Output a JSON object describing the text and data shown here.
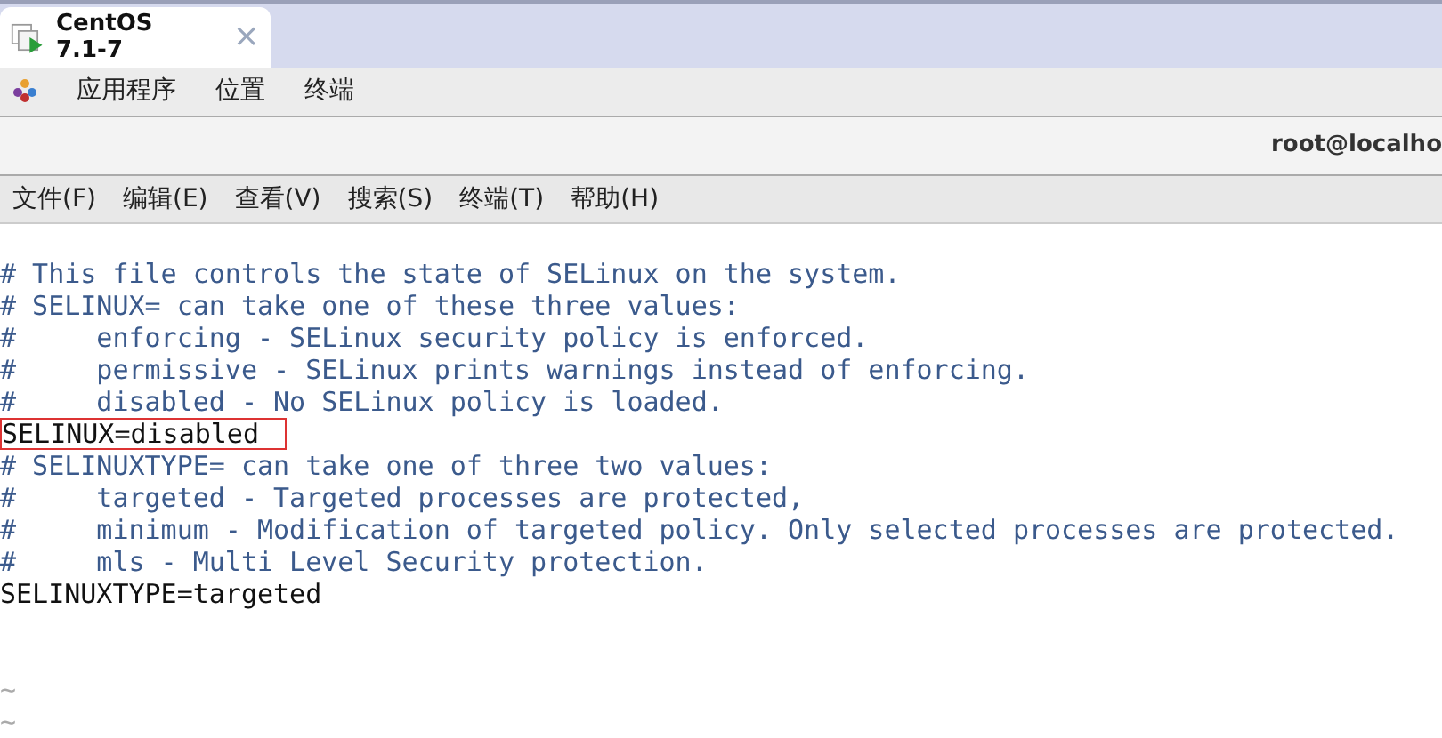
{
  "tabs": [
    {
      "label": "CentOS 7.1-7",
      "selected": true,
      "close": "×"
    }
  ],
  "top_menu": [
    "应用程序",
    "位置",
    "终端"
  ],
  "window": {
    "title": "root@localho"
  },
  "menu": [
    "文件(F)",
    "编辑(E)",
    "查看(V)",
    "搜索(S)",
    "终端(T)",
    "帮助(H)"
  ],
  "lines": [
    {
      "kind": "comment",
      "text": "# This file controls the state of SELinux on the system.",
      "boxed": false
    },
    {
      "kind": "comment",
      "text": "# SELINUX= can take one of these three values:",
      "boxed": false
    },
    {
      "kind": "comment",
      "text": "#     enforcing - SELinux security policy is enforced.",
      "boxed": false
    },
    {
      "kind": "comment",
      "text": "#     permissive - SELinux prints warnings instead of enforcing.",
      "boxed": false
    },
    {
      "kind": "comment",
      "text": "#     disabled - No SELinux policy is loaded.",
      "boxed": false
    },
    {
      "kind": "code",
      "text": "SELINUX=disabled",
      "boxed": true
    },
    {
      "kind": "comment",
      "text": "# SELINUXTYPE= can take one of three two values:",
      "boxed": false
    },
    {
      "kind": "comment",
      "text": "#     targeted - Targeted processes are protected,",
      "boxed": false
    },
    {
      "kind": "comment",
      "text": "#     minimum - Modification of targeted policy. Only selected processes are protected.",
      "boxed": false
    },
    {
      "kind": "comment",
      "text": "#     mls - Multi Level Security protection.",
      "boxed": false
    },
    {
      "kind": "code",
      "text": "SELINUXTYPE=targeted",
      "boxed": false
    },
    {
      "kind": "blank"
    },
    {
      "kind": "blank"
    },
    {
      "kind": "tilde",
      "text": "~"
    },
    {
      "kind": "tilde",
      "text": "~"
    }
  ]
}
